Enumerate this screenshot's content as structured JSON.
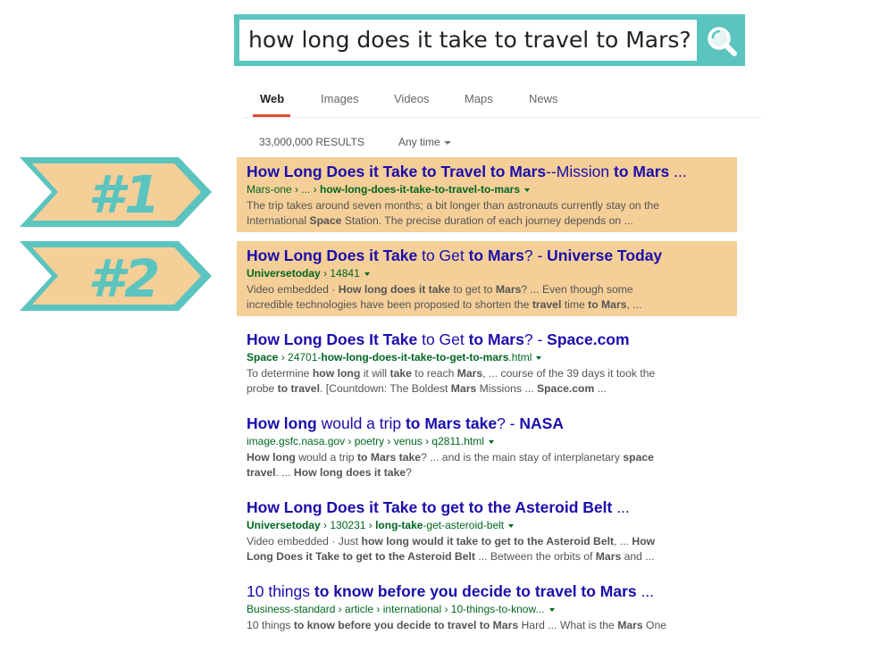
{
  "search": {
    "query": "how long does it take to travel to Mars?"
  },
  "tabs": [
    {
      "label": "Web",
      "active": true
    },
    {
      "label": "Images"
    },
    {
      "label": "Videos"
    },
    {
      "label": "Maps"
    },
    {
      "label": "News"
    }
  ],
  "results_count": "33,000,000 RESULTS",
  "time_filter": "Any time",
  "ranks": [
    "#1",
    "#2"
  ],
  "colors": {
    "teal": "#5bc4bf",
    "highlight": "#f5cf98",
    "link": "#1a0dab",
    "url": "#006621",
    "tab_underline": "#dd4b39"
  },
  "results": [
    {
      "title": [
        [
          "How Long Does it Take to Travel to Mars",
          true
        ],
        [
          "--Mission ",
          false
        ],
        [
          "to Mars",
          true
        ],
        [
          " ...",
          false
        ]
      ],
      "url": [
        [
          "Mars-one › ... › ",
          false
        ],
        [
          "how-long-does-it-take-to-travel-to-mars",
          true
        ]
      ],
      "snippet": [
        [
          [
            "The trip takes around seven months; a bit longer than astronauts currently stay on the",
            false
          ]
        ],
        [
          [
            "International ",
            false
          ],
          [
            "Space",
            true
          ],
          [
            " Station. The precise duration of each journey depends on ...",
            false
          ]
        ]
      ]
    },
    {
      "title": [
        [
          "How Long Does it Take",
          true
        ],
        [
          " to Get ",
          false
        ],
        [
          "to Mars",
          true
        ],
        [
          "? - ",
          false
        ],
        [
          "Universe Today",
          true
        ]
      ],
      "url": [
        [
          "Universetoday",
          true
        ],
        [
          " › 14841",
          false
        ]
      ],
      "snippet": [
        [
          [
            "Video embedded · ",
            false
          ],
          [
            "How long does it take",
            true
          ],
          [
            " to get to ",
            false
          ],
          [
            "Mars",
            true
          ],
          [
            "? ... Even though some",
            false
          ]
        ],
        [
          [
            "incredible technologies have been proposed to shorten the ",
            false
          ],
          [
            "travel",
            true
          ],
          [
            " time ",
            false
          ],
          [
            "to Mars",
            true
          ],
          [
            ", ...",
            false
          ]
        ]
      ]
    },
    {
      "title": [
        [
          "How Long Does It Take",
          true
        ],
        [
          " to Get ",
          false
        ],
        [
          "to Mars",
          true
        ],
        [
          "? - ",
          false
        ],
        [
          "Space.com",
          true
        ]
      ],
      "url": [
        [
          "Space",
          true
        ],
        [
          " › 24701-",
          false
        ],
        [
          "how-long-does-it-take-to-get-to-mars",
          true
        ],
        [
          ".html",
          false
        ]
      ],
      "snippet": [
        [
          [
            "To determine ",
            false
          ],
          [
            "how long",
            true
          ],
          [
            " it will ",
            false
          ],
          [
            "take",
            true
          ],
          [
            " to reach ",
            false
          ],
          [
            "Mars",
            true
          ],
          [
            ", ... course of the 39 days it took the",
            false
          ]
        ],
        [
          [
            "probe ",
            false
          ],
          [
            "to travel",
            true
          ],
          [
            ". [Countdown: The Boldest ",
            false
          ],
          [
            "Mars",
            true
          ],
          [
            " Missions ... ",
            false
          ],
          [
            "Space.com",
            true
          ],
          [
            " ...",
            false
          ]
        ]
      ]
    },
    {
      "title": [
        [
          "How long",
          true
        ],
        [
          " would a trip ",
          false
        ],
        [
          "to Mars take",
          true
        ],
        [
          "? - ",
          false
        ],
        [
          "NASA",
          true
        ]
      ],
      "url": [
        [
          "image.gsfc.nasa.gov › poetry › venus › q2811.html",
          false
        ]
      ],
      "snippet": [
        [
          [
            "How long",
            true
          ],
          [
            " would a trip ",
            false
          ],
          [
            "to Mars take",
            true
          ],
          [
            "? ... and is the main stay of interplanetary ",
            false
          ],
          [
            "space",
            true
          ]
        ],
        [
          [
            "travel",
            true
          ],
          [
            ". ... ",
            false
          ],
          [
            "How long does it take",
            true
          ],
          [
            "?",
            false
          ]
        ]
      ]
    },
    {
      "title": [
        [
          "How Long Does it Take to get to the Asteroid Belt",
          true
        ],
        [
          " ...",
          false
        ]
      ],
      "url": [
        [
          "Universetoday",
          true
        ],
        [
          " › 130231 › ",
          false
        ],
        [
          "long-take",
          true
        ],
        [
          "-get-asteroid-belt",
          false
        ]
      ],
      "snippet": [
        [
          [
            "Video embedded · Just ",
            false
          ],
          [
            "how long would it take to get to the Asteroid Belt",
            true
          ],
          [
            ", ... ",
            false
          ],
          [
            "How",
            true
          ]
        ],
        [
          [
            "Long Does it Take to get to the Asteroid Belt",
            true
          ],
          [
            " ... Between the orbits of ",
            false
          ],
          [
            "Mars",
            true
          ],
          [
            " and ...",
            false
          ]
        ]
      ]
    },
    {
      "title": [
        [
          "10 things ",
          false
        ],
        [
          "to know before you decide to travel to Mars",
          true
        ],
        [
          " ...",
          false
        ]
      ],
      "url": [
        [
          "Business-standard › article › international › 10-things-to-know...",
          false
        ]
      ],
      "snippet": [
        [
          [
            "10 things ",
            false
          ],
          [
            "to know before you decide to travel to Mars",
            true
          ],
          [
            " Hard ... What is the ",
            false
          ],
          [
            "Mars",
            true
          ],
          [
            " One",
            false
          ]
        ]
      ]
    }
  ]
}
